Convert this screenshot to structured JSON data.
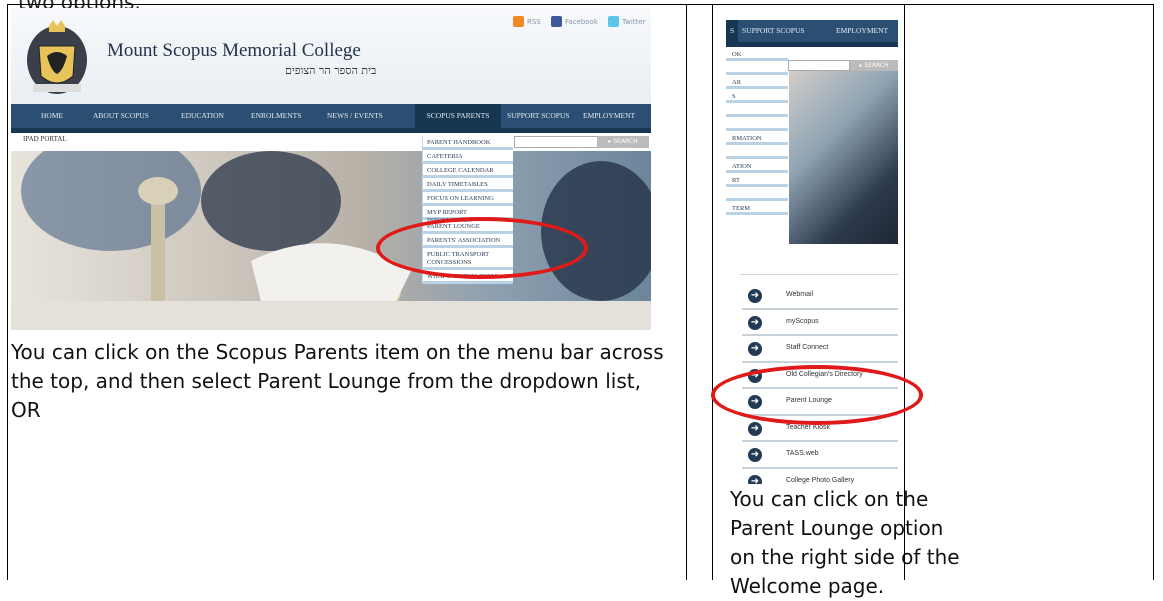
{
  "page": {
    "header_clip": "two options.",
    "left_instructions": "You can click on the Scopus Parents item on the menu bar across the top, and then select Parent Lounge from the dropdown list, OR",
    "right_instructions": "You can click on the Parent Lounge option on the right side of the Welcome page."
  },
  "site": {
    "title": "Mount Scopus Memorial College",
    "hebrew": "בית הספר הר הצופים",
    "social": [
      "RSS",
      "Facebook",
      "Twitter"
    ],
    "nav": [
      "HOME",
      "ABOUT SCOPUS",
      "EDUCATION",
      "ENROLMENTS",
      "NEWS / EVENTS",
      "SCOPUS PARENTS",
      "SUPPORT SCOPUS",
      "EMPLOYMENT"
    ],
    "sub_nav": "IPAD PORTAL",
    "search_label": "SEARCH",
    "dropdown": [
      "PARENT HANDBOOK",
      "CAFETERIA",
      "COLLEGE CALENDAR",
      "DAILY TIMETABLES",
      "FOCUS ON LEARNING",
      "MYP REPORT INFORMATION",
      "PARENT LOUNGE",
      "PARENTS' ASSOCIATION",
      "PUBLIC TRANSPORT CONCESSIONS",
      "WHAT'S ON THIS TERM"
    ]
  },
  "right_site": {
    "nav": [
      "S",
      "SUPPORT SCOPUS",
      "EMPLOYMENT"
    ],
    "menu": [
      "OK",
      "",
      "AR",
      "S",
      "",
      "",
      "RMATION",
      "",
      "ATION",
      "RT",
      "",
      "TERM"
    ],
    "search_label": "SEARCH",
    "links": [
      "Webmail",
      "myScopus",
      "Staff Connect",
      "Old Collegian's Directory",
      "Parent Lounge",
      "Teacher Kiosk",
      "TASS.web",
      "College Photo Gallery"
    ]
  },
  "colors": {
    "nav_bg": "#2a4f73",
    "highlight": "#e01919"
  }
}
